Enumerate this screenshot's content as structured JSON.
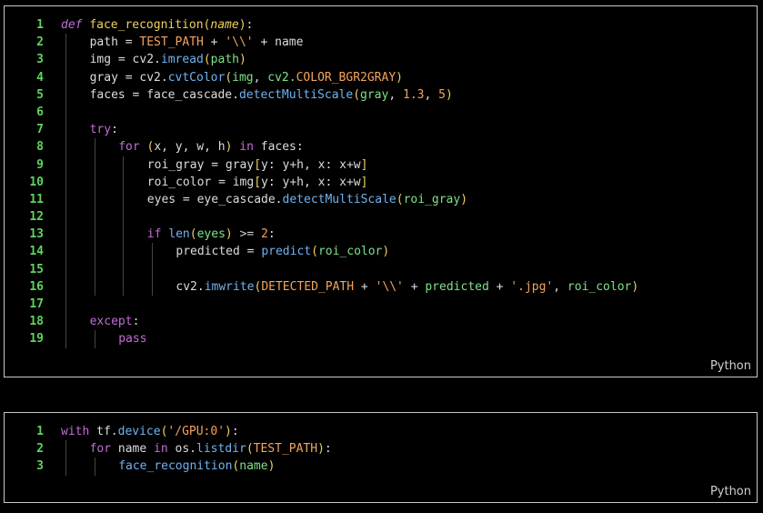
{
  "blocks": [
    {
      "language": "Python",
      "lines": [
        {
          "n": "1",
          "indent": 0,
          "tokens": [
            [
              "kwd",
              "def"
            ],
            [
              "var",
              " "
            ],
            [
              "fn",
              "face_recognition"
            ],
            [
              "bl",
              "("
            ],
            [
              "par",
              "name"
            ],
            [
              "bl",
              ")"
            ],
            [
              "var",
              ":"
            ]
          ]
        },
        {
          "n": "2",
          "indent": 1,
          "tokens": [
            [
              "var",
              "path = "
            ],
            [
              "const",
              "TEST_PATH"
            ],
            [
              "var",
              " + "
            ],
            [
              "str",
              "'\\\\'"
            ],
            [
              "var",
              " + name"
            ]
          ]
        },
        {
          "n": "3",
          "indent": 1,
          "tokens": [
            [
              "var",
              "img = cv2."
            ],
            [
              "meth",
              "imread"
            ],
            [
              "bl",
              "("
            ],
            [
              "g",
              "path"
            ],
            [
              "bl",
              ")"
            ]
          ]
        },
        {
          "n": "4",
          "indent": 1,
          "tokens": [
            [
              "var",
              "gray = cv2."
            ],
            [
              "meth",
              "cvtColor"
            ],
            [
              "bl",
              "("
            ],
            [
              "g",
              "img"
            ],
            [
              "var",
              ", "
            ],
            [
              "g",
              "cv2."
            ],
            [
              "const",
              "COLOR_BGR2GRAY"
            ],
            [
              "bl",
              ")"
            ]
          ]
        },
        {
          "n": "5",
          "indent": 1,
          "tokens": [
            [
              "var",
              "faces = face_cascade."
            ],
            [
              "meth",
              "detectMultiScale"
            ],
            [
              "bl",
              "("
            ],
            [
              "g",
              "gray"
            ],
            [
              "var",
              ", "
            ],
            [
              "num",
              "1.3"
            ],
            [
              "var",
              ", "
            ],
            [
              "num",
              "5"
            ],
            [
              "bl",
              ")"
            ]
          ]
        },
        {
          "n": "6",
          "indent": 1,
          "tokens": []
        },
        {
          "n": "7",
          "indent": 1,
          "tokens": [
            [
              "kw",
              "try"
            ],
            [
              "var",
              ":"
            ]
          ]
        },
        {
          "n": "8",
          "indent": 2,
          "tokens": [
            [
              "kw",
              "for"
            ],
            [
              "var",
              " "
            ],
            [
              "bl",
              "("
            ],
            [
              "var",
              "x, y, w, h"
            ],
            [
              "bl",
              ")"
            ],
            [
              "var",
              " "
            ],
            [
              "kw",
              "in"
            ],
            [
              "var",
              " faces:"
            ]
          ]
        },
        {
          "n": "9",
          "indent": 3,
          "tokens": [
            [
              "var",
              "roi_gray = gray"
            ],
            [
              "bl",
              "["
            ],
            [
              "var",
              "y: y"
            ],
            [
              "op",
              "+"
            ],
            [
              "var",
              "h, x: x"
            ],
            [
              "op",
              "+"
            ],
            [
              "var",
              "w"
            ],
            [
              "bl",
              "]"
            ]
          ]
        },
        {
          "n": "10",
          "indent": 3,
          "tokens": [
            [
              "var",
              "roi_color = img"
            ],
            [
              "bl",
              "["
            ],
            [
              "var",
              "y: y"
            ],
            [
              "op",
              "+"
            ],
            [
              "var",
              "h, x: x"
            ],
            [
              "op",
              "+"
            ],
            [
              "var",
              "w"
            ],
            [
              "bl",
              "]"
            ]
          ]
        },
        {
          "n": "11",
          "indent": 3,
          "tokens": [
            [
              "var",
              "eyes = eye_cascade."
            ],
            [
              "meth",
              "detectMultiScale"
            ],
            [
              "bl",
              "("
            ],
            [
              "g",
              "roi_gray"
            ],
            [
              "bl",
              ")"
            ]
          ]
        },
        {
          "n": "12",
          "indent": 3,
          "tokens": []
        },
        {
          "n": "13",
          "indent": 3,
          "tokens": [
            [
              "kw",
              "if"
            ],
            [
              "var",
              " "
            ],
            [
              "meth",
              "len"
            ],
            [
              "bl",
              "("
            ],
            [
              "g",
              "eyes"
            ],
            [
              "bl",
              ")"
            ],
            [
              "var",
              " "
            ],
            [
              "op",
              ">="
            ],
            [
              "var",
              " "
            ],
            [
              "num",
              "2"
            ],
            [
              "var",
              ":"
            ]
          ]
        },
        {
          "n": "14",
          "indent": 4,
          "tokens": [
            [
              "var",
              "predicted = "
            ],
            [
              "meth",
              "predict"
            ],
            [
              "bl",
              "("
            ],
            [
              "g",
              "roi_color"
            ],
            [
              "bl",
              ")"
            ]
          ]
        },
        {
          "n": "15",
          "indent": 4,
          "tokens": []
        },
        {
          "n": "16",
          "indent": 4,
          "tokens": [
            [
              "var",
              "cv2."
            ],
            [
              "meth",
              "imwrite"
            ],
            [
              "bl",
              "("
            ],
            [
              "const",
              "DETECTED_PATH"
            ],
            [
              "var",
              " + "
            ],
            [
              "str",
              "'\\\\'"
            ],
            [
              "var",
              " + "
            ],
            [
              "g",
              "predicted"
            ],
            [
              "var",
              " + "
            ],
            [
              "str",
              "'.jpg'"
            ],
            [
              "var",
              ", "
            ],
            [
              "g",
              "roi_color"
            ],
            [
              "bl",
              ")"
            ]
          ]
        },
        {
          "n": "17",
          "indent": 1,
          "tokens": []
        },
        {
          "n": "18",
          "indent": 1,
          "tokens": [
            [
              "kw",
              "except"
            ],
            [
              "var",
              ":"
            ]
          ]
        },
        {
          "n": "19",
          "indent": 2,
          "tokens": [
            [
              "kw",
              "pass"
            ]
          ]
        }
      ]
    },
    {
      "language": "Python",
      "lines": [
        {
          "n": "1",
          "indent": 0,
          "tokens": [
            [
              "kw",
              "with"
            ],
            [
              "var",
              " tf."
            ],
            [
              "meth",
              "device"
            ],
            [
              "bl",
              "("
            ],
            [
              "str",
              "'/GPU:0'"
            ],
            [
              "bl",
              ")"
            ],
            [
              "var",
              ":"
            ]
          ]
        },
        {
          "n": "2",
          "indent": 1,
          "tokens": [
            [
              "kw",
              "for"
            ],
            [
              "var",
              " name "
            ],
            [
              "kw",
              "in"
            ],
            [
              "var",
              " os."
            ],
            [
              "meth",
              "listdir"
            ],
            [
              "bl",
              "("
            ],
            [
              "const",
              "TEST_PATH"
            ],
            [
              "bl",
              ")"
            ],
            [
              "var",
              ":"
            ]
          ]
        },
        {
          "n": "3",
          "indent": 2,
          "tokens": [
            [
              "meth",
              "face_recognition"
            ],
            [
              "bl",
              "("
            ],
            [
              "g",
              "name"
            ],
            [
              "bl",
              ")"
            ]
          ]
        }
      ]
    }
  ]
}
